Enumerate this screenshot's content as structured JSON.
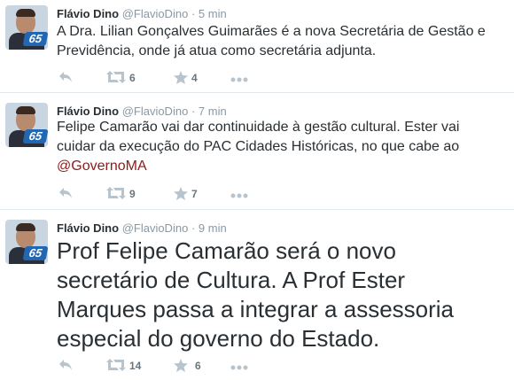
{
  "tweets": [
    {
      "name": "Flávio Dino",
      "handle": "@FlavioDino",
      "dot": "·",
      "time": "5 min",
      "badge": "65",
      "text": "A Dra. Lilian Gonçalves Guimarães é a nova Secretária de Gestão e Previdência, onde já atua como secretária adjunta.",
      "retweets": "6",
      "favorites": "4"
    },
    {
      "name": "Flávio Dino",
      "handle": "@FlavioDino",
      "dot": "·",
      "time": "7 min",
      "badge": "65",
      "text": "Felipe Camarão vai dar continuidade à gestão cultural. Ester vai cuidar da execução do PAC Cidades Históricas, no que cabe ao",
      "mention": "@GovernoMA",
      "retweets": "9",
      "favorites": "7"
    },
    {
      "name": "Flávio Dino",
      "handle": "@FlavioDino",
      "dot": "·",
      "time": "9 min",
      "badge": "65",
      "text": "Prof Felipe Camarão será o novo secretário de Cultura. A Prof Ester Marques passa a integrar a assessoria especial do governo do Estado.",
      "retweets": "14",
      "favorites": "6"
    }
  ],
  "icons": {
    "reply": "reply-icon",
    "retweet": "retweet-icon",
    "favorite": "star-icon",
    "more": "more-icon"
  }
}
